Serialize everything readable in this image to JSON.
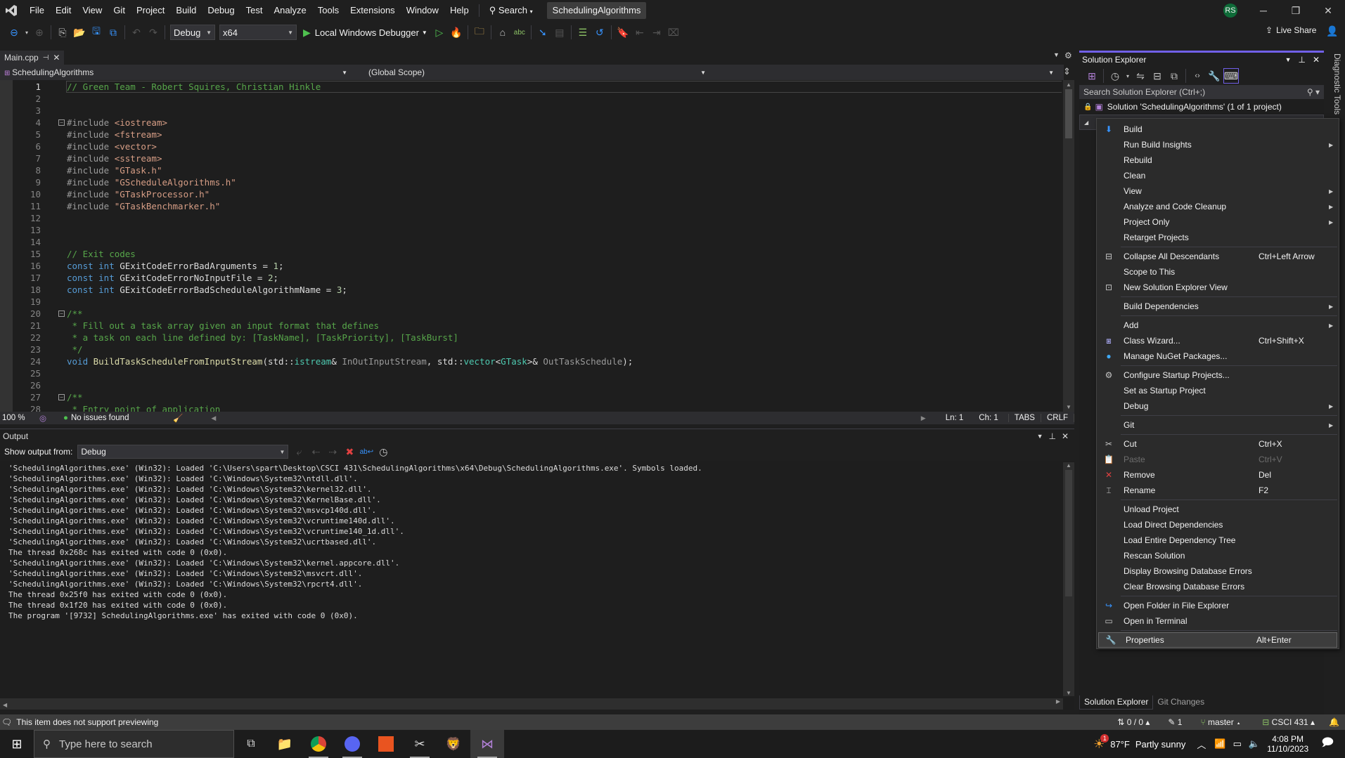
{
  "menubar": {
    "items": [
      "File",
      "Edit",
      "View",
      "Git",
      "Project",
      "Build",
      "Debug",
      "Test",
      "Analyze",
      "Tools",
      "Extensions",
      "Window",
      "Help"
    ],
    "search_label": "Search",
    "solution_name": "SchedulingAlgorithms",
    "user_initials": "RS",
    "user_color": "#0e6b38"
  },
  "toolbar": {
    "config": "Debug",
    "platform": "x64",
    "run_label": "Local Windows Debugger",
    "live_share": "Live Share"
  },
  "editor": {
    "tab_name": "Main.cpp",
    "project_combo": "SchedulingAlgorithms",
    "scope_combo": "(Global Scope)",
    "zoom": "100 %",
    "issues": "No issues found",
    "line": "Ln: 1",
    "col": "Ch: 1",
    "indent": "TABS",
    "eol": "CRLF",
    "lines": [
      {
        "n": "1",
        "t": [
          [
            "cm",
            "// Green Team - Robert Squires, Christian Hinkle"
          ]
        ]
      },
      {
        "n": "2",
        "t": []
      },
      {
        "n": "3",
        "t": []
      },
      {
        "n": "4",
        "fold": true,
        "t": [
          [
            "pp",
            "#include "
          ],
          [
            "str",
            "<iostream>"
          ]
        ]
      },
      {
        "n": "5",
        "t": [
          [
            "pp",
            "#include "
          ],
          [
            "str",
            "<fstream>"
          ]
        ]
      },
      {
        "n": "6",
        "t": [
          [
            "pp",
            "#include "
          ],
          [
            "str",
            "<vector>"
          ]
        ]
      },
      {
        "n": "7",
        "t": [
          [
            "pp",
            "#include "
          ],
          [
            "str",
            "<sstream>"
          ]
        ]
      },
      {
        "n": "8",
        "t": [
          [
            "pp",
            "#include "
          ],
          [
            "str",
            "\"GTask.h\""
          ]
        ]
      },
      {
        "n": "9",
        "t": [
          [
            "pp",
            "#include "
          ],
          [
            "str",
            "\"GScheduleAlgorithms.h\""
          ]
        ]
      },
      {
        "n": "10",
        "t": [
          [
            "pp",
            "#include "
          ],
          [
            "str",
            "\"GTaskProcessor.h\""
          ]
        ]
      },
      {
        "n": "11",
        "t": [
          [
            "pp",
            "#include "
          ],
          [
            "str",
            "\"GTaskBenchmarker.h\""
          ]
        ]
      },
      {
        "n": "12",
        "t": []
      },
      {
        "n": "13",
        "t": []
      },
      {
        "n": "14",
        "t": []
      },
      {
        "n": "15",
        "t": [
          [
            "cm",
            "// Exit codes"
          ]
        ]
      },
      {
        "n": "16",
        "t": [
          [
            "kw",
            "const int "
          ],
          [
            "pl",
            "GExitCodeErrorBadArguments = "
          ],
          [
            "nm",
            "1"
          ],
          [
            "pl",
            ";"
          ]
        ]
      },
      {
        "n": "17",
        "t": [
          [
            "kw",
            "const int "
          ],
          [
            "pl",
            "GExitCodeErrorNoInputFile = "
          ],
          [
            "nm",
            "2"
          ],
          [
            "pl",
            ";"
          ]
        ]
      },
      {
        "n": "18",
        "t": [
          [
            "kw",
            "const int "
          ],
          [
            "pl",
            "GExitCodeErrorBadScheduleAlgorithmName = "
          ],
          [
            "nm",
            "3"
          ],
          [
            "pl",
            ";"
          ]
        ]
      },
      {
        "n": "19",
        "t": []
      },
      {
        "n": "20",
        "fold": true,
        "t": [
          [
            "cm",
            "/**"
          ]
        ]
      },
      {
        "n": "21",
        "t": [
          [
            "cm",
            " * Fill out a task array given an input format that defines"
          ]
        ]
      },
      {
        "n": "22",
        "t": [
          [
            "cm",
            " * a task on each line defined by: [TaskName], [TaskPriority], [TaskBurst]"
          ]
        ]
      },
      {
        "n": "23",
        "t": [
          [
            "cm",
            " */"
          ]
        ]
      },
      {
        "n": "24",
        "t": [
          [
            "kw",
            "void "
          ],
          [
            "fn",
            "BuildTaskScheduleFromInputStream"
          ],
          [
            "pl",
            "(std::"
          ],
          [
            "ty",
            "istream"
          ],
          [
            "pl",
            "& "
          ],
          [
            "pr",
            "InOutInputStream"
          ],
          [
            "pl",
            ", std::"
          ],
          [
            "ty",
            "vector"
          ],
          [
            "pl",
            "<"
          ],
          [
            "ty",
            "GTask"
          ],
          [
            "pl",
            ">& "
          ],
          [
            "pr",
            "OutTaskSchedule"
          ],
          [
            "pl",
            ");"
          ]
        ]
      },
      {
        "n": "25",
        "t": []
      },
      {
        "n": "26",
        "t": []
      },
      {
        "n": "27",
        "fold": true,
        "t": [
          [
            "cm",
            "/**"
          ]
        ]
      },
      {
        "n": "28",
        "t": [
          [
            "cm",
            " * Entry point of application"
          ]
        ]
      }
    ]
  },
  "output": {
    "title": "Output",
    "show_from_label": "Show output from:",
    "source": "Debug",
    "lines": [
      "'SchedulingAlgorithms.exe' (Win32): Loaded 'C:\\Users\\spart\\Desktop\\CSCI 431\\SchedulingAlgorithms\\x64\\Debug\\SchedulingAlgorithms.exe'. Symbols loaded.",
      "'SchedulingAlgorithms.exe' (Win32): Loaded 'C:\\Windows\\System32\\ntdll.dll'.",
      "'SchedulingAlgorithms.exe' (Win32): Loaded 'C:\\Windows\\System32\\kernel32.dll'.",
      "'SchedulingAlgorithms.exe' (Win32): Loaded 'C:\\Windows\\System32\\KernelBase.dll'.",
      "'SchedulingAlgorithms.exe' (Win32): Loaded 'C:\\Windows\\System32\\msvcp140d.dll'.",
      "'SchedulingAlgorithms.exe' (Win32): Loaded 'C:\\Windows\\System32\\vcruntime140d.dll'.",
      "'SchedulingAlgorithms.exe' (Win32): Loaded 'C:\\Windows\\System32\\vcruntime140_1d.dll'.",
      "'SchedulingAlgorithms.exe' (Win32): Loaded 'C:\\Windows\\System32\\ucrtbased.dll'.",
      "The thread 0x268c has exited with code 0 (0x0).",
      "'SchedulingAlgorithms.exe' (Win32): Loaded 'C:\\Windows\\System32\\kernel.appcore.dll'.",
      "'SchedulingAlgorithms.exe' (Win32): Loaded 'C:\\Windows\\System32\\msvcrt.dll'.",
      "'SchedulingAlgorithms.exe' (Win32): Loaded 'C:\\Windows\\System32\\rpcrt4.dll'.",
      "The thread 0x25f0 has exited with code 0 (0x0).",
      "The thread 0x1f20 has exited with code 0 (0x0).",
      "The program '[9732] SchedulingAlgorithms.exe' has exited with code 0 (0x0)."
    ]
  },
  "solution_explorer": {
    "title": "Solution Explorer",
    "search_placeholder": "Search Solution Explorer (Ctrl+;)",
    "solution_row": "Solution 'SchedulingAlgorithms' (1 of 1 project)",
    "diagnostic_tools": "Diagnostic Tools",
    "bottom_tabs": [
      "Solution Explorer",
      "Git Changes"
    ]
  },
  "context_menu": {
    "items": [
      {
        "icon": "build",
        "label": "Build",
        "shortcut": "",
        "sub": false
      },
      {
        "icon": "",
        "label": "Run Build Insights",
        "shortcut": "",
        "sub": true
      },
      {
        "icon": "",
        "label": "Rebuild",
        "shortcut": "",
        "sub": false
      },
      {
        "icon": "",
        "label": "Clean",
        "shortcut": "",
        "sub": false
      },
      {
        "icon": "",
        "label": "View",
        "shortcut": "",
        "sub": true
      },
      {
        "icon": "",
        "label": "Analyze and Code Cleanup",
        "shortcut": "",
        "sub": true
      },
      {
        "icon": "",
        "label": "Project Only",
        "shortcut": "",
        "sub": true
      },
      {
        "icon": "",
        "label": "Retarget Projects",
        "shortcut": "",
        "sub": false
      },
      {
        "sep": true
      },
      {
        "icon": "collapse",
        "label": "Collapse All Descendants",
        "shortcut": "Ctrl+Left Arrow",
        "sub": false
      },
      {
        "icon": "",
        "label": "Scope to This",
        "shortcut": "",
        "sub": false
      },
      {
        "icon": "new-view",
        "label": "New Solution Explorer View",
        "shortcut": "",
        "sub": false
      },
      {
        "sep": true
      },
      {
        "icon": "",
        "label": "Build Dependencies",
        "shortcut": "",
        "sub": true
      },
      {
        "sep": true
      },
      {
        "icon": "",
        "label": "Add",
        "shortcut": "",
        "sub": true
      },
      {
        "icon": "class-wizard",
        "label": "Class Wizard...",
        "shortcut": "Ctrl+Shift+X",
        "sub": false
      },
      {
        "icon": "nuget",
        "label": "Manage NuGet Packages...",
        "shortcut": "",
        "sub": false
      },
      {
        "sep": true
      },
      {
        "icon": "gear",
        "label": "Configure Startup Projects...",
        "shortcut": "",
        "sub": false
      },
      {
        "icon": "",
        "label": "Set as Startup Project",
        "shortcut": "",
        "sub": false
      },
      {
        "icon": "",
        "label": "Debug",
        "shortcut": "",
        "sub": true
      },
      {
        "sep": true
      },
      {
        "icon": "",
        "label": "Git",
        "shortcut": "",
        "sub": true
      },
      {
        "sep": true
      },
      {
        "icon": "cut",
        "label": "Cut",
        "shortcut": "Ctrl+X",
        "sub": false
      },
      {
        "icon": "paste",
        "label": "Paste",
        "shortcut": "Ctrl+V",
        "sub": false,
        "disabled": true
      },
      {
        "icon": "remove",
        "label": "Remove",
        "shortcut": "Del",
        "sub": false
      },
      {
        "icon": "rename",
        "label": "Rename",
        "shortcut": "F2",
        "sub": false
      },
      {
        "sep": true
      },
      {
        "icon": "",
        "label": "Unload Project",
        "shortcut": "",
        "sub": false
      },
      {
        "icon": "",
        "label": "Load Direct Dependencies",
        "shortcut": "",
        "sub": false
      },
      {
        "icon": "",
        "label": "Load Entire Dependency Tree",
        "shortcut": "",
        "sub": false
      },
      {
        "icon": "",
        "label": "Rescan Solution",
        "shortcut": "",
        "sub": false
      },
      {
        "icon": "",
        "label": "Display Browsing Database Errors",
        "shortcut": "",
        "sub": false
      },
      {
        "icon": "",
        "label": "Clear Browsing Database Errors",
        "shortcut": "",
        "sub": false
      },
      {
        "sep": true
      },
      {
        "icon": "open-folder",
        "label": "Open Folder in File Explorer",
        "shortcut": "",
        "sub": false
      },
      {
        "icon": "terminal",
        "label": "Open in Terminal",
        "shortcut": "",
        "sub": false
      },
      {
        "sep": true
      },
      {
        "icon": "wrench",
        "label": "Properties",
        "shortcut": "Alt+Enter",
        "sub": false,
        "highlighted": true
      }
    ]
  },
  "statusbar": {
    "message": "This item does not support previewing",
    "sync": "0 / 0",
    "changes": "1",
    "branch": "master",
    "repo": "CSCI 431"
  },
  "taskbar": {
    "search_placeholder": "Type here to search",
    "weather_temp": "87°F",
    "weather_desc": "Partly sunny",
    "weather_badge": "1",
    "time": "4:08 PM",
    "date": "11/10/2023"
  }
}
